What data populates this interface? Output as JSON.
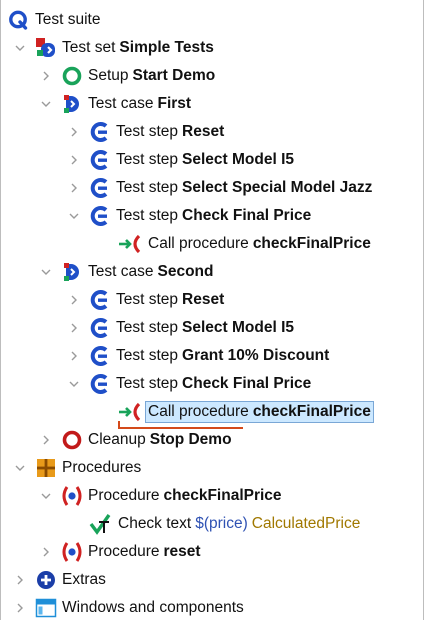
{
  "colors": {
    "selection_bg": "#cce8ff",
    "selection_border": "#7aa7d6",
    "drop_marker": "#d44a1a",
    "variable": "#2f52b3",
    "value_text": "#a07800"
  },
  "tree": {
    "root": {
      "icon": "test-suite-icon",
      "label": "Test suite"
    },
    "test_set": {
      "type": "Test set",
      "name": "Simple Tests",
      "icon": "test-set-icon",
      "expanded": true
    },
    "setup": {
      "type": "Setup",
      "name": "Start Demo",
      "icon": "setup-icon",
      "expanded": false
    },
    "case1": {
      "type": "Test case",
      "name": "First",
      "icon": "test-case-icon",
      "expanded": true,
      "steps": [
        {
          "type": "Test step",
          "name": "Reset",
          "expanded": false
        },
        {
          "type": "Test step",
          "name": "Select Model I5",
          "expanded": false
        },
        {
          "type": "Test step",
          "name": "Select Special Model Jazz",
          "expanded": false
        },
        {
          "type": "Test step",
          "name": "Check Final Price",
          "expanded": true
        }
      ],
      "call": {
        "type": "Call procedure",
        "name": "checkFinalPrice"
      }
    },
    "case2": {
      "type": "Test case",
      "name": "Second",
      "icon": "test-case-icon",
      "expanded": true,
      "steps": [
        {
          "type": "Test step",
          "name": "Reset",
          "expanded": false
        },
        {
          "type": "Test step",
          "name": "Select Model I5",
          "expanded": false
        },
        {
          "type": "Test step",
          "name": "Grant 10% Discount",
          "expanded": false
        },
        {
          "type": "Test step",
          "name": "Check Final Price",
          "expanded": true
        }
      ],
      "call": {
        "type": "Call procedure",
        "name": "checkFinalPrice",
        "selected": true
      }
    },
    "cleanup": {
      "type": "Cleanup",
      "name": "Stop Demo",
      "icon": "cleanup-icon",
      "expanded": false
    },
    "procedures": {
      "label": "Procedures",
      "icon": "package-icon",
      "expanded": true,
      "proc1": {
        "type": "Procedure",
        "name": "checkFinalPrice",
        "expanded": true
      },
      "check": {
        "type": "Check text",
        "variable": "$(price)",
        "value": "CalculatedPrice"
      },
      "proc2": {
        "type": "Procedure",
        "name": "reset",
        "expanded": false
      }
    },
    "extras": {
      "label": "Extras",
      "icon": "extras-icon",
      "expanded": false
    },
    "windows": {
      "label": "Windows and components",
      "icon": "window-icon",
      "expanded": false
    }
  }
}
